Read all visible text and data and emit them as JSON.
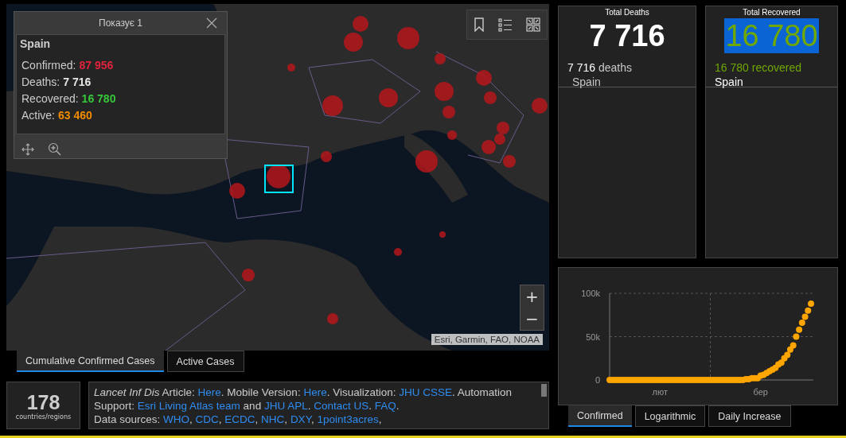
{
  "map": {
    "kind": "picture",
    "attribution": "Esri, Garmin, FAO, NOAA",
    "zoom_buttons": [
      "+",
      "−"
    ]
  },
  "popup": {
    "title": "Показує 1",
    "country": "Spain",
    "stats": [
      {
        "label": "Confirmed:",
        "value": "87 956",
        "color": "#e0243c"
      },
      {
        "label": "Deaths:",
        "value": "7 716",
        "color": "#e6e6e6"
      },
      {
        "label": "Recovered:",
        "value": "16 780",
        "color": "#35c83a"
      },
      {
        "label": "Active:",
        "value": "63 460",
        "color": "#f08c00"
      }
    ]
  },
  "map_tabs": [
    {
      "label": "Cumulative Confirmed Cases",
      "selected": true
    },
    {
      "label": "Active Cases",
      "selected": false
    }
  ],
  "country_count": {
    "value": "178",
    "label": "countries/regions"
  },
  "info": [
    {
      "kind": "text",
      "text": "*Lancet Inf Dis* Article: "
    },
    {
      "kind": "link",
      "text": "Here"
    },
    {
      "kind": "text",
      "text": ". Mobile Version: "
    },
    {
      "kind": "link",
      "text": "Here"
    },
    {
      "kind": "text",
      "text": ". Visualization: "
    },
    {
      "kind": "link",
      "text": "JHU CSSE"
    },
    {
      "kind": "text",
      "text": ". Automation Support: "
    },
    {
      "kind": "link",
      "text": "Esri Living Atlas team"
    },
    {
      "kind": "text",
      "text": " and "
    },
    {
      "kind": "link",
      "text": "JHU APL"
    },
    {
      "kind": "text",
      "text": ". "
    },
    {
      "kind": "link",
      "text": "Contact US"
    },
    {
      "kind": "text",
      "text": ". "
    },
    {
      "kind": "link",
      "text": "FAQ"
    },
    {
      "kind": "text",
      "text": "."
    },
    {
      "kind": "break"
    },
    {
      "kind": "text",
      "text": "Data sources: "
    },
    {
      "kind": "link",
      "text": "WHO"
    },
    {
      "kind": "text",
      "text": ", "
    },
    {
      "kind": "link",
      "text": "CDC"
    },
    {
      "kind": "text",
      "text": ", "
    },
    {
      "kind": "link",
      "text": "ECDC"
    },
    {
      "kind": "text",
      "text": ", "
    },
    {
      "kind": "link",
      "text": "NHC"
    },
    {
      "kind": "text",
      "text": ", "
    },
    {
      "kind": "link",
      "text": "DXY"
    },
    {
      "kind": "text",
      "text": ", "
    },
    {
      "kind": "link",
      "text": "1point3acres"
    },
    {
      "kind": "text",
      "text": ","
    }
  ],
  "panels": [
    {
      "kind": "deaths",
      "title": "Total Deaths",
      "value": "7 716",
      "value_highlighted": false,
      "count": "7 716",
      "count_label": "deaths",
      "place": "Spain"
    },
    {
      "kind": "recovered",
      "title": "Total Recovered",
      "value": "16 780",
      "value_highlighted": true,
      "count": "16 780",
      "count_label": "recovered",
      "place": "Spain"
    }
  ],
  "chart": {
    "chart_data": {
      "type": "scatter",
      "ylim": [
        0,
        100000
      ],
      "yticks": [
        {
          "value": 0,
          "label": "0"
        },
        {
          "value": 50000,
          "label": "50k"
        },
        {
          "value": 100000,
          "label": "100k"
        }
      ],
      "categories": [
        null,
        null,
        null,
        null,
        null,
        null,
        null,
        null,
        null,
        null,
        null,
        null,
        null,
        null,
        null,
        null,
        null,
        "лют",
        null,
        null,
        null,
        null,
        null,
        null,
        null,
        null,
        null,
        null,
        null,
        null,
        null,
        null,
        null,
        null,
        null,
        null,
        null,
        null,
        null,
        null,
        null,
        null,
        null,
        null,
        null,
        null,
        null,
        null,
        null,
        null,
        null,
        "бер",
        null,
        null,
        null,
        null,
        null,
        null,
        null,
        null,
        null,
        null,
        null,
        null,
        null,
        null,
        null,
        null,
        null
      ],
      "series": [
        {
          "color": "#ffa500",
          "values": [
            0,
            0,
            0,
            0,
            0,
            0,
            0,
            0,
            0,
            0,
            0,
            0,
            0,
            0,
            0,
            0,
            0,
            0,
            0,
            0,
            0,
            0,
            0,
            0,
            0,
            0,
            0,
            0,
            0,
            0,
            0,
            0,
            0,
            0,
            0,
            0,
            0,
            0,
            0,
            0,
            0,
            0,
            0,
            0,
            0,
            0,
            1000,
            1000,
            2000,
            2000,
            2000,
            5000,
            6000,
            8000,
            10000,
            12000,
            14000,
            18000,
            20000,
            25000,
            29000,
            35000,
            40000,
            50000,
            58000,
            66000,
            73000,
            80000,
            88000
          ]
        }
      ]
    },
    "tabs": [
      {
        "label": "Confirmed",
        "selected": true
      },
      {
        "label": "Logarithmic",
        "selected": false
      },
      {
        "label": "Daily Increase",
        "selected": false
      }
    ]
  }
}
